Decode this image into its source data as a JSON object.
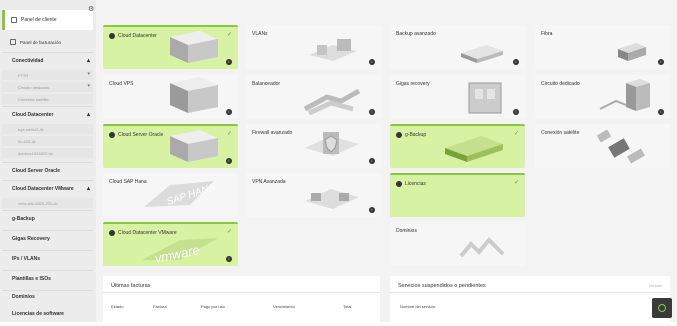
{
  "sidebar": {
    "top_item": {
      "label": "Panel de cliente"
    },
    "second_item": {
      "label": "Panel de facturación"
    },
    "sections": [
      {
        "label": "Conectividad",
        "has_caret": true
      },
      {
        "label": "Cloud Datacenter",
        "has_caret": true
      },
      {
        "label": "Cloud Datacenter VMware",
        "has_caret": true
      }
    ],
    "conectividad_subitems": [
      "FTTH",
      "Circuito dedicado",
      "Conexión satélite"
    ],
    "datacenter_subitems": [
      "bge-mbh42-dc",
      "dc-403-dc",
      "dcmbvc1934322-dc"
    ],
    "vmware_subitems": [
      "vmw-vdc-4820-201-dc"
    ],
    "main_items": [
      "Cloud Server Oracle",
      "g-Backup",
      "Gigas Recovery",
      "IPs / VLANs",
      "Plantillas e ISOs",
      "Dominios",
      "Licencias de software"
    ]
  },
  "tiles": [
    {
      "label": "Cloud Datacenter",
      "active": true,
      "check": true
    },
    {
      "label": "VLANs",
      "active": false,
      "check": false
    },
    {
      "label": "Backup avanzado",
      "active": false,
      "check": false
    },
    {
      "label": "Fibra",
      "active": false,
      "check": false
    },
    {
      "label": "Cloud VPS",
      "active": false,
      "check": false
    },
    {
      "label": "Balanceador",
      "active": false,
      "check": false
    },
    {
      "label": "Gigas recovery",
      "active": false,
      "check": false
    },
    {
      "label": "Circuito dedicado",
      "active": false,
      "check": false
    },
    {
      "label": "Cloud Server Oracle",
      "active": true,
      "check": true
    },
    {
      "label": "Firewall avanzado",
      "active": false,
      "check": false
    },
    {
      "label": "g-Backup",
      "active": true,
      "check": true
    },
    {
      "label": "Conexión satélite",
      "active": false,
      "check": false
    },
    {
      "label": "Cloud SAP Hana",
      "active": false,
      "check": false
    },
    {
      "label": "VPN Avanzada",
      "active": false,
      "check": false
    },
    {
      "label": "Licencias",
      "active": true,
      "check": true
    },
    {
      "label": "Cloud Datacenter VMware",
      "active": true,
      "check": true
    },
    {
      "label": "Dominios",
      "active": false,
      "check": false
    }
  ],
  "tile_art": {
    "sap": "SAP HANA",
    "vmware": "vmware"
  },
  "panels": {
    "invoices": {
      "title": "Últimas facturas",
      "columns": [
        "Estado",
        "Factura",
        "Pago por uso",
        "Vencimiento",
        "Total"
      ]
    },
    "services": {
      "title": "Servicios suspendidos o pendientes",
      "more": "Ver todo",
      "columns": [
        "Nombre del servicio"
      ]
    }
  },
  "colors": {
    "accent": "#8cc63f",
    "active_tile": "#d8f2a4",
    "dark": "#333333"
  }
}
